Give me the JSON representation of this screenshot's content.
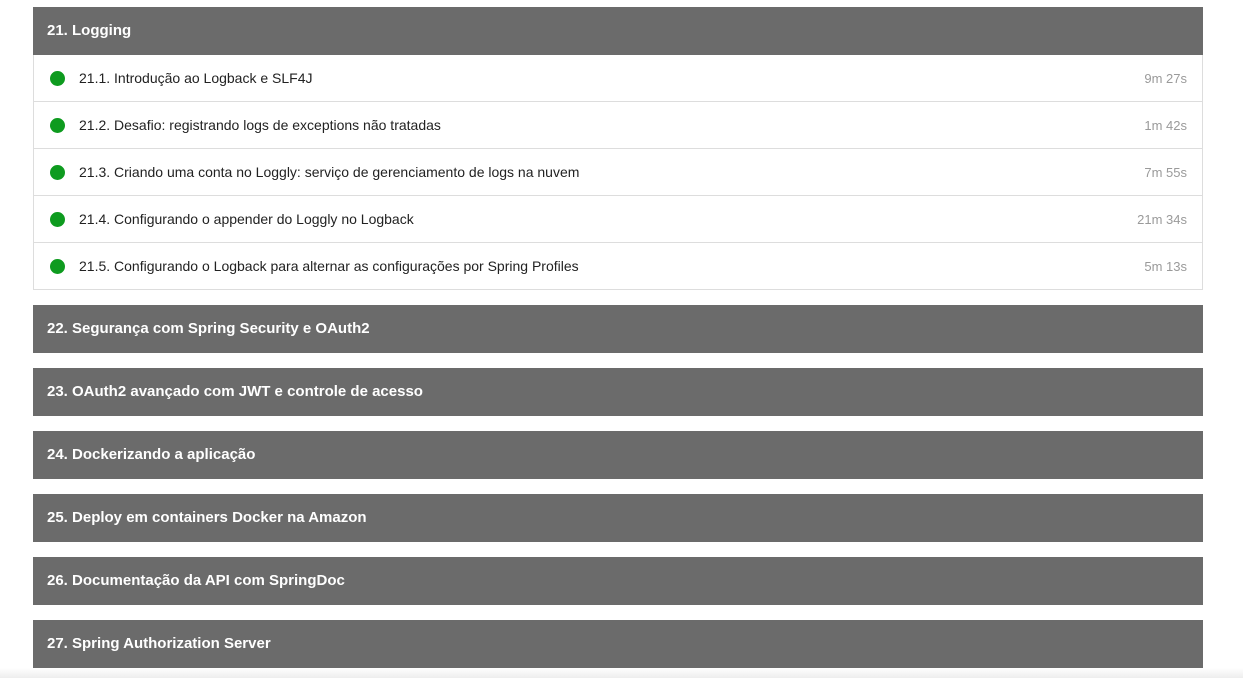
{
  "status_color": "#0e9b1f",
  "header_color": "#6b6b6b",
  "modules": [
    {
      "title": "21. Logging",
      "lessons": [
        {
          "title": "21.1. Introdução ao Logback e SLF4J",
          "duration": "9m 27s",
          "status_icon": "completed-dot-icon"
        },
        {
          "title": "21.2. Desafio: registrando logs de exceptions não tratadas",
          "duration": "1m 42s",
          "status_icon": "completed-dot-icon"
        },
        {
          "title": "21.3. Criando uma conta no Loggly: serviço de gerenciamento de logs na nuvem",
          "duration": "7m 55s",
          "status_icon": "completed-dot-icon"
        },
        {
          "title": "21.4. Configurando o appender do Loggly no Logback",
          "duration": "21m 34s",
          "status_icon": "completed-dot-icon"
        },
        {
          "title": "21.5. Configurando o Logback para alternar as configurações por Spring Profiles",
          "duration": "5m 13s",
          "status_icon": "completed-dot-icon"
        }
      ]
    },
    {
      "title": "22. Segurança com Spring Security e OAuth2"
    },
    {
      "title": "23. OAuth2 avançado com JWT e controle de acesso"
    },
    {
      "title": "24. Dockerizando a aplicação"
    },
    {
      "title": "25. Deploy em containers Docker na Amazon"
    },
    {
      "title": "26. Documentação da API com SpringDoc"
    },
    {
      "title": "27. Spring Authorization Server"
    }
  ]
}
